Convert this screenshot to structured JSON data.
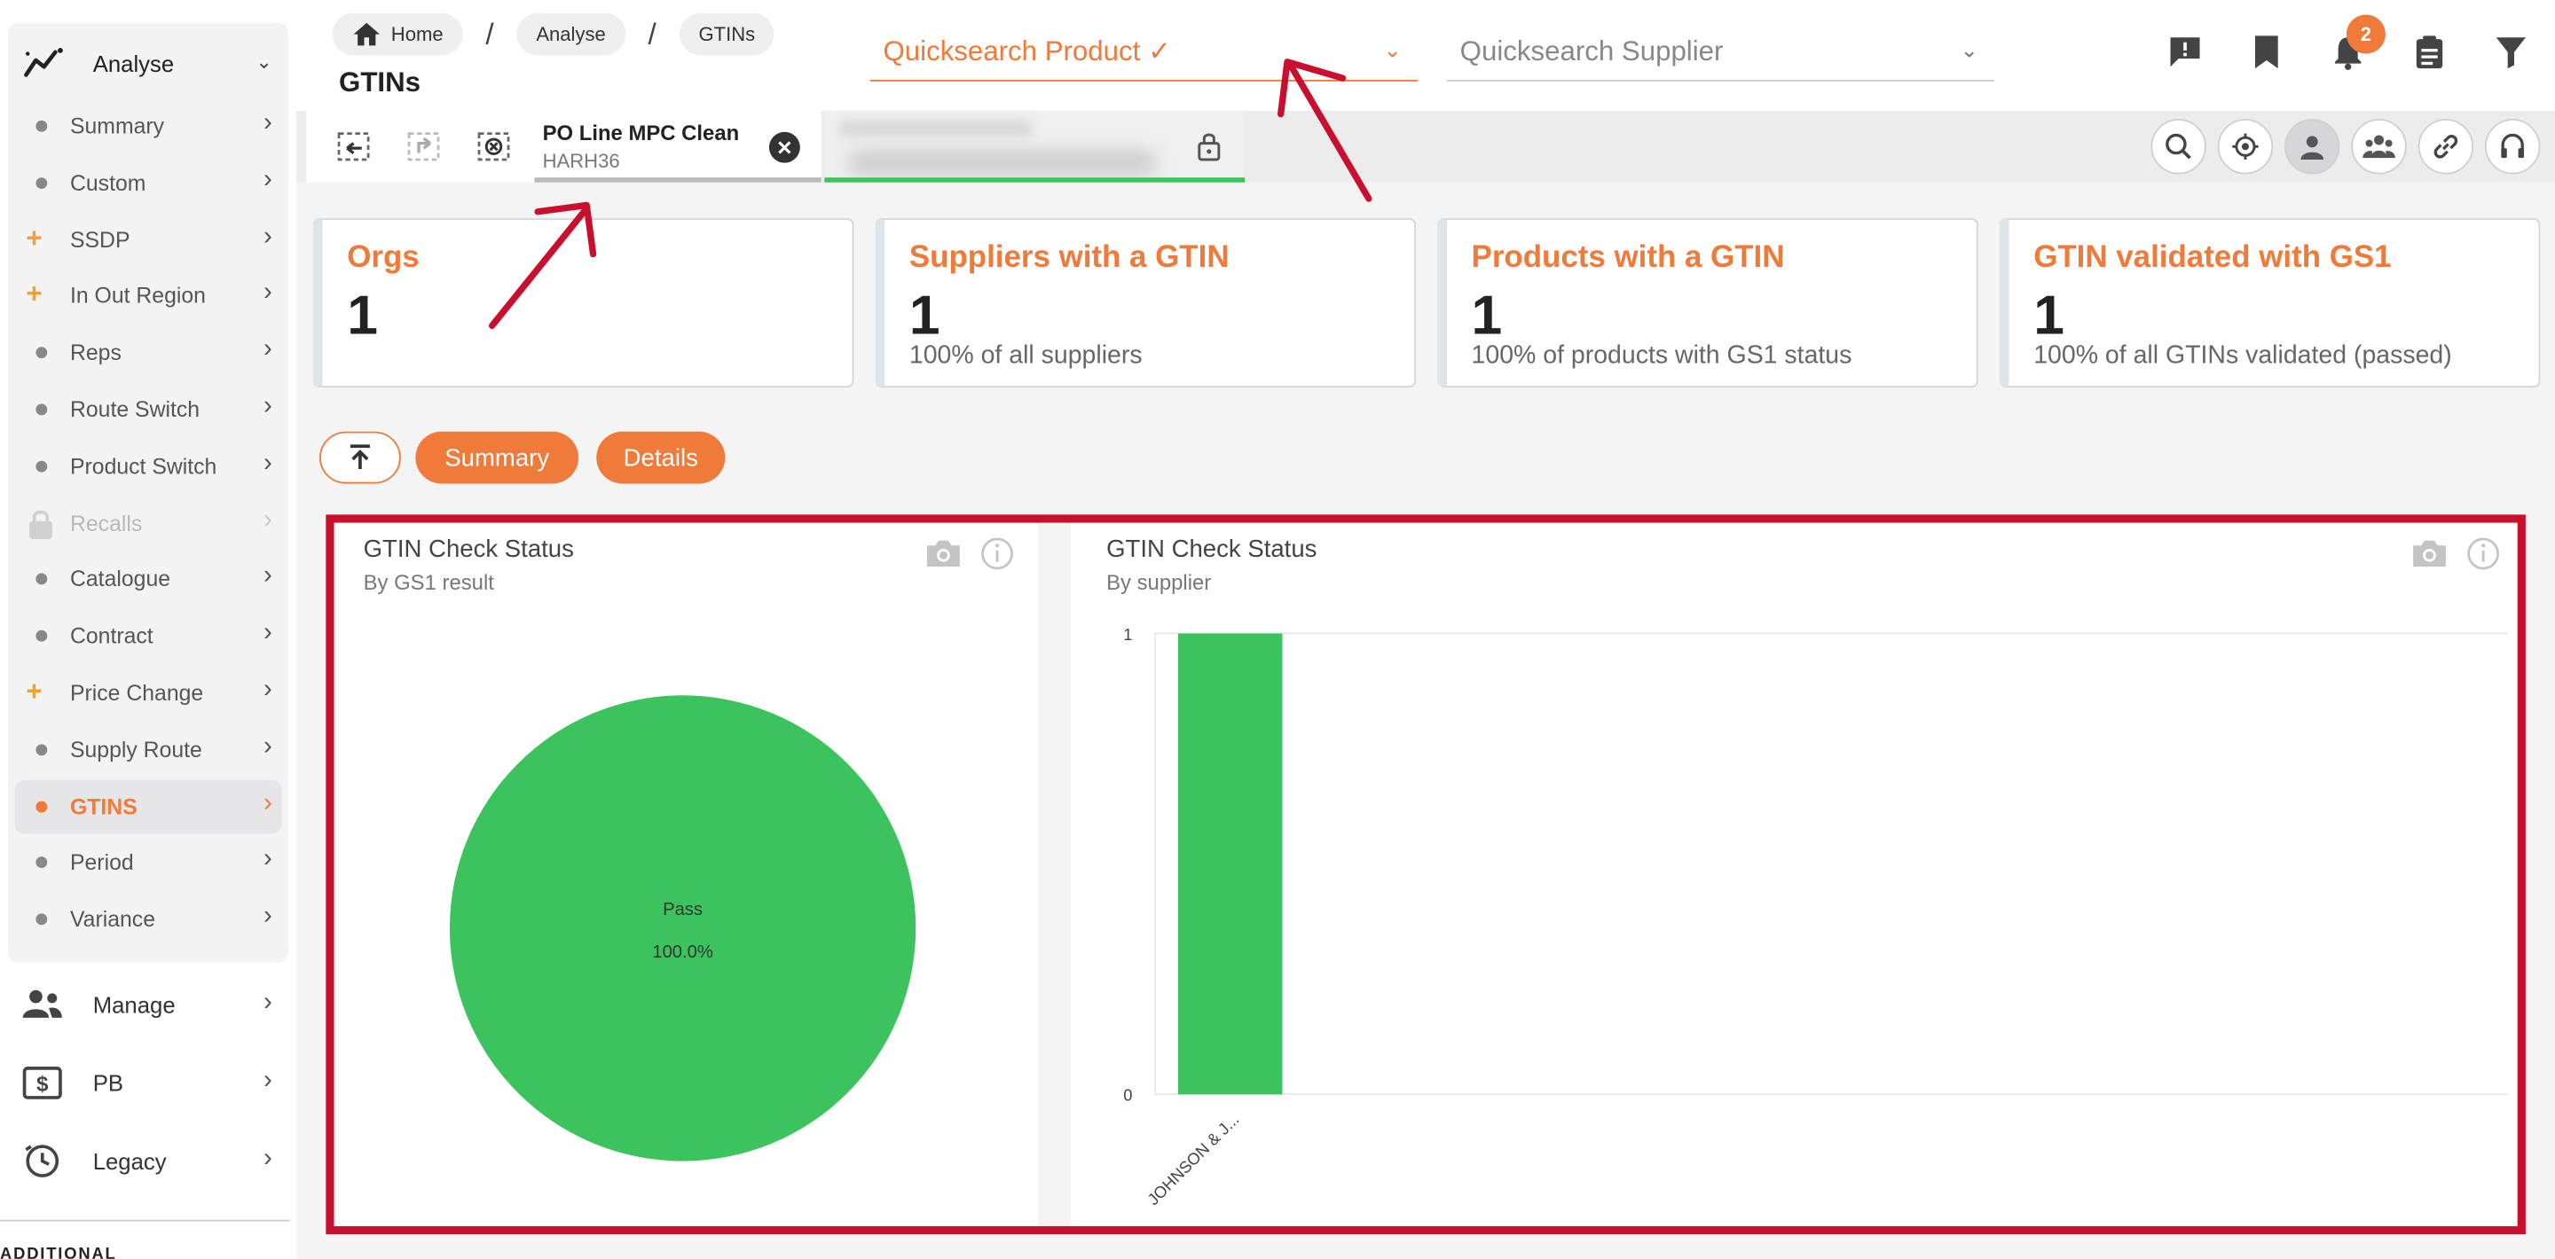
{
  "sidebar": {
    "group_label": "Analyse",
    "items": [
      {
        "label": "Summary",
        "marker": "bullet"
      },
      {
        "label": "Custom",
        "marker": "bullet"
      },
      {
        "label": "SSDP",
        "marker": "plus"
      },
      {
        "label": "In Out Region",
        "marker": "plus"
      },
      {
        "label": "Reps",
        "marker": "bullet"
      },
      {
        "label": "Route Switch",
        "marker": "bullet"
      },
      {
        "label": "Product Switch",
        "marker": "bullet"
      },
      {
        "label": "Recalls",
        "marker": "lock"
      },
      {
        "label": "Catalogue",
        "marker": "bullet"
      },
      {
        "label": "Contract",
        "marker": "bullet"
      },
      {
        "label": "Price Change",
        "marker": "plus"
      },
      {
        "label": "Supply Route",
        "marker": "bullet"
      },
      {
        "label": "GTINS",
        "marker": "bullet"
      },
      {
        "label": "Period",
        "marker": "bullet"
      },
      {
        "label": "Variance",
        "marker": "bullet"
      }
    ],
    "active_index": 12,
    "sections": [
      {
        "label": "Manage",
        "icon": "people-icon"
      },
      {
        "label": "PB",
        "icon": "dollar-icon"
      },
      {
        "label": "Legacy",
        "icon": "clock-icon"
      }
    ],
    "additional_label": "ADDITIONAL"
  },
  "header": {
    "breadcrumbs": [
      "Home",
      "Analyse",
      "GTINs"
    ],
    "page_title": "GTINs",
    "quicksearch_product": "Quicksearch Product ✓",
    "quicksearch_supplier": "Quicksearch Supplier",
    "notification_count": "2"
  },
  "tab": {
    "title": "PO Line MPC Clean",
    "subtitle": "HARH36"
  },
  "cards": [
    {
      "title": "Orgs",
      "value": "1",
      "sub": ""
    },
    {
      "title": "Suppliers with a GTIN",
      "value": "1",
      "sub": "100% of all suppliers"
    },
    {
      "title": "Products with a GTIN",
      "value": "1",
      "sub": "100% of products with GS1 status"
    },
    {
      "title": "GTIN validated with GS1",
      "value": "1",
      "sub": "100% of all GTINs validated (passed)"
    }
  ],
  "view_tabs": {
    "summary": "Summary",
    "details": "Details"
  },
  "charts": [
    {
      "title": "GTIN Check Status",
      "subtitle": "By GS1 result"
    },
    {
      "title": "GTIN Check Status",
      "subtitle": "By supplier"
    }
  ],
  "chart_data": [
    {
      "type": "pie",
      "title": "GTIN Check Status",
      "subtitle": "By GS1 result",
      "categories": [
        "Pass"
      ],
      "values": [
        100.0
      ],
      "value_labels": [
        "100.0%"
      ],
      "colors": [
        "#3cc35e"
      ]
    },
    {
      "type": "bar",
      "title": "GTIN Check Status",
      "subtitle": "By supplier",
      "categories": [
        "JOHNSON & J..."
      ],
      "values": [
        1
      ],
      "ylim": [
        0,
        1
      ],
      "yticks": [
        "0",
        "1"
      ],
      "colors": [
        "#3cc35e"
      ]
    }
  ],
  "colors": {
    "accent": "#ef7a3a",
    "pass": "#3cc35e",
    "highlight": "#c8102e"
  }
}
